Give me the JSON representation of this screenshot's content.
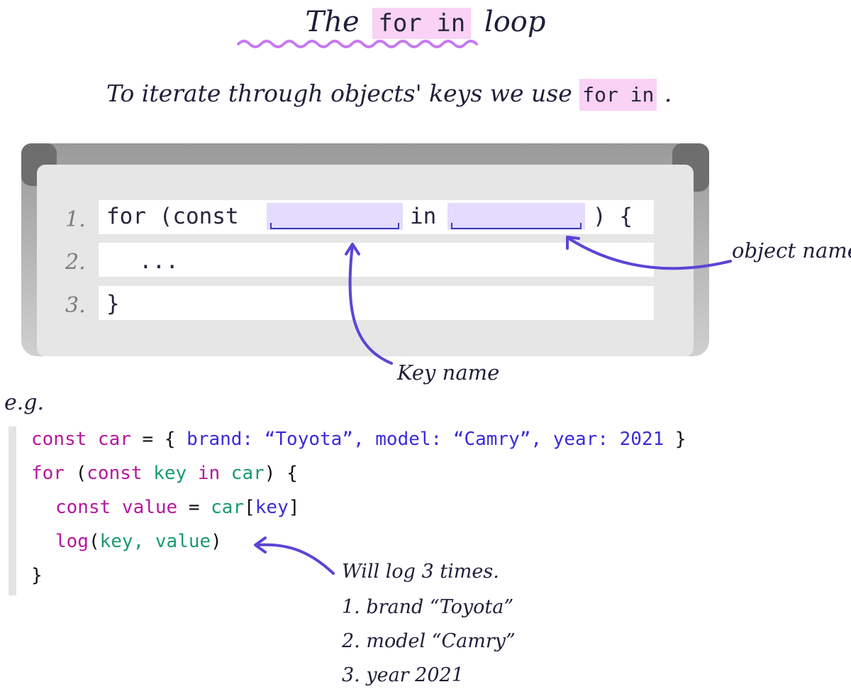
{
  "title": {
    "pre": "The",
    "code": "for in",
    "post": "loop"
  },
  "intro": {
    "text": "To iterate through objects' keys we use",
    "code": "for in",
    "end": "."
  },
  "board": {
    "line_numbers": [
      "1.",
      "2.",
      "3."
    ],
    "line1_a": "for (const",
    "line1_in": "in",
    "line1_b": ") {",
    "line2": "...",
    "line3": "}"
  },
  "annotations": {
    "object_name": "object name",
    "key_name": "Key name"
  },
  "example": {
    "label": "e.g.",
    "l1": {
      "a": "const car",
      "b": " = {",
      "c": " brand: “Toyota”, model: “Camry”, year: 2021",
      "d": " }"
    },
    "l2": {
      "a": "for",
      "b": " (",
      "c": "const",
      "d": " key",
      "e": " in",
      "f": " car",
      "g": ") {"
    },
    "l3": {
      "a": "const value",
      "b": " = ",
      "c": "car",
      "d": "[",
      "e": "key",
      "f": "]"
    },
    "l4": {
      "a": "log",
      "b": "(",
      "c": "key, value",
      "d": ")"
    },
    "l5": "}"
  },
  "note": {
    "heading": "Will log 3 times.",
    "items": [
      "1. brand “Toyota”",
      "2. model “Camry”",
      "3. year 2021"
    ]
  },
  "colors": {
    "highlight": "#f9d2f5",
    "blank": "#e4dbff",
    "arrow": "#5b45d6",
    "keyword": "#b5179e",
    "identifier": "#1a9b6c",
    "literal": "#3a2bdc"
  }
}
